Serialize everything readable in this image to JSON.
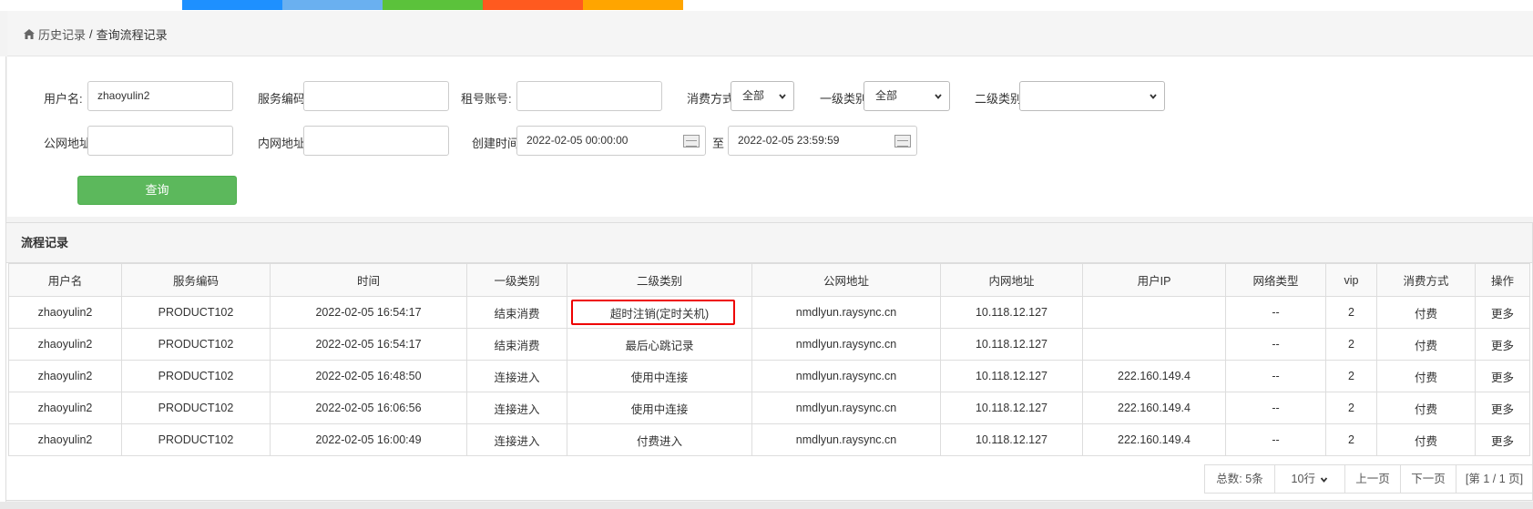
{
  "top_tabs": [
    {
      "label": "",
      "color": "#1e90ff"
    },
    {
      "label": "",
      "color": "#6ab0f0"
    },
    {
      "label": "",
      "color": "#5bc23b"
    },
    {
      "label": "",
      "color": "#ff5a1f"
    },
    {
      "label": "",
      "color": "#ffa500"
    }
  ],
  "breadcrumb": {
    "icon": "home-icon",
    "parent": "历史记录",
    "separator": "/",
    "current": "查询流程记录"
  },
  "form": {
    "username_label": "用户名:",
    "username_value": "zhaoyulin2",
    "service_code_label": "服务编码",
    "service_code_value": "",
    "rent_account_label": "租号账号:",
    "rent_account_value": "",
    "consume_mode_label": "消费方式",
    "consume_mode_value": "全部",
    "level1_label": "一级类别",
    "level1_value": "全部",
    "level2_label": "二级类别",
    "level2_value": "",
    "public_ip_label": "公网地址",
    "public_ip_value": "",
    "private_ip_label": "内网地址",
    "private_ip_value": "",
    "created_label": "创建时间",
    "created_from": "2022-02-05 00:00:00",
    "to_label": "至",
    "created_to": "2022-02-05 23:59:59",
    "query_button": "查询"
  },
  "records": {
    "title": "流程记录",
    "columns": [
      "用户名",
      "服务编码",
      "时间",
      "一级类别",
      "二级类别",
      "公网地址",
      "内网地址",
      "用户IP",
      "网络类型",
      "vip",
      "消费方式",
      "操作"
    ],
    "rows": [
      [
        "zhaoyulin2",
        "PRODUCT102",
        "2022-02-05 16:54:17",
        "结束消费",
        "超时注销(定时关机)",
        "nmdlyun.raysync.cn",
        "10.118.12.127",
        "",
        "--",
        "2",
        "付费",
        "更多"
      ],
      [
        "zhaoyulin2",
        "PRODUCT102",
        "2022-02-05 16:54:17",
        "结束消费",
        "最后心跳记录",
        "nmdlyun.raysync.cn",
        "10.118.12.127",
        "",
        "--",
        "2",
        "付费",
        "更多"
      ],
      [
        "zhaoyulin2",
        "PRODUCT102",
        "2022-02-05 16:48:50",
        "连接进入",
        "使用中连接",
        "nmdlyun.raysync.cn",
        "10.118.12.127",
        "222.160.149.4",
        "--",
        "2",
        "付费",
        "更多"
      ],
      [
        "zhaoyulin2",
        "PRODUCT102",
        "2022-02-05 16:06:56",
        "连接进入",
        "使用中连接",
        "nmdlyun.raysync.cn",
        "10.118.12.127",
        "222.160.149.4",
        "--",
        "2",
        "付费",
        "更多"
      ],
      [
        "zhaoyulin2",
        "PRODUCT102",
        "2022-02-05 16:00:49",
        "连接进入",
        "付费进入",
        "nmdlyun.raysync.cn",
        "10.118.12.127",
        "222.160.149.4",
        "--",
        "2",
        "付费",
        "更多"
      ]
    ],
    "highlight_color": "#e00000"
  },
  "pagination": {
    "total": "总数: 5条",
    "page_size": "10行",
    "prev": "上一页",
    "next": "下一页",
    "page_info": "[第 1 / 1 页]"
  }
}
